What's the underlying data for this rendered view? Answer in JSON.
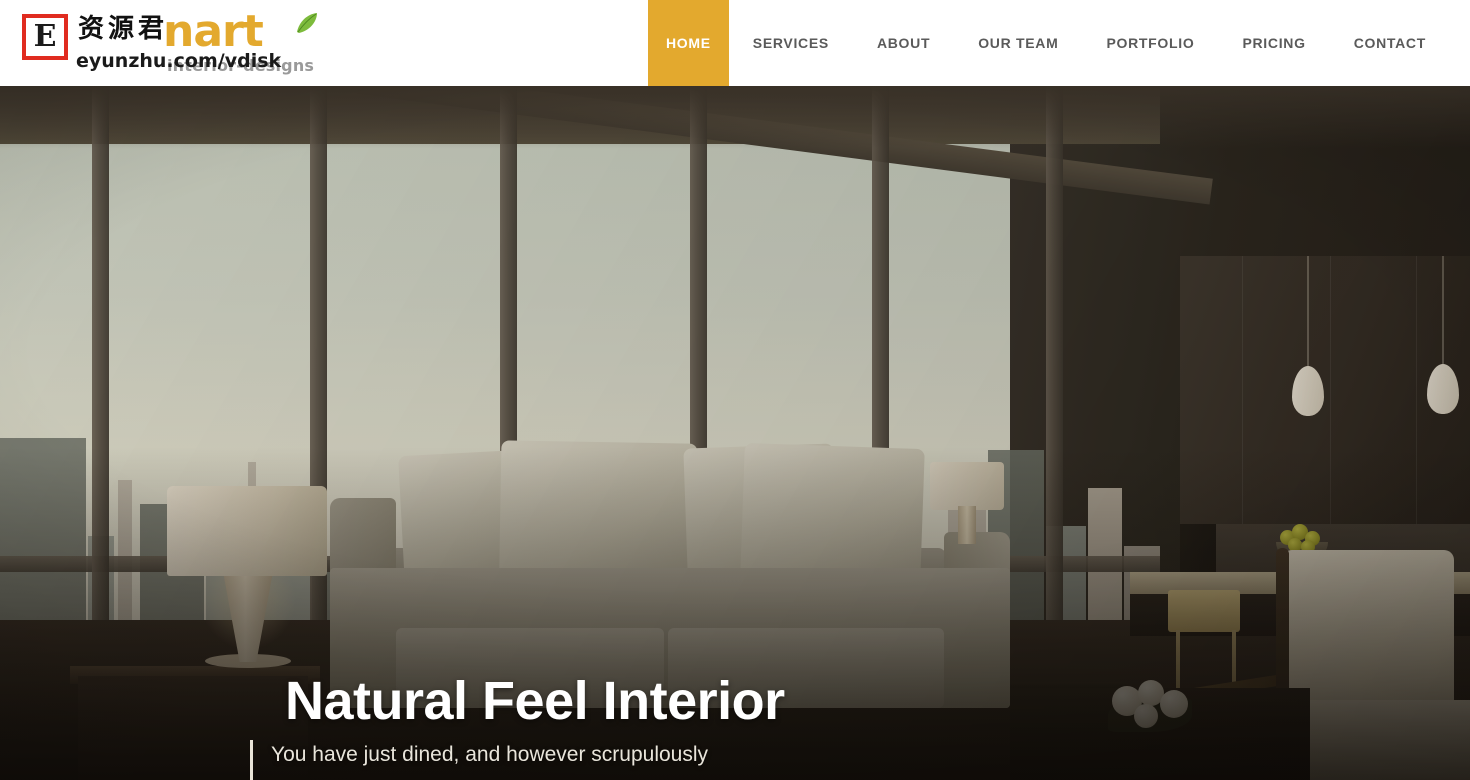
{
  "header": {
    "brand": {
      "name": "nart",
      "tagline": "interior-designs",
      "leaf_icon": "leaf-icon",
      "accent_color": "#E3A92E"
    },
    "watermark": {
      "badge_letter": "E",
      "chinese_text": "资源君",
      "url": "eyunzhu.com/vdisk",
      "badge_color": "#E02B20"
    },
    "nav": {
      "items": [
        {
          "label": "HOME",
          "active": true
        },
        {
          "label": "SERVICES",
          "active": false
        },
        {
          "label": "ABOUT",
          "active": false
        },
        {
          "label": "OUR TEAM",
          "active": false
        },
        {
          "label": "PORTFOLIO",
          "active": false
        },
        {
          "label": "PRICING",
          "active": false
        },
        {
          "label": "CONTACT",
          "active": false
        }
      ],
      "active_bg": "#E3A92E",
      "active_text": "#FFFFFF",
      "text_color": "#5A5A5A"
    }
  },
  "hero": {
    "title": "Natural Feel Interior",
    "subtitle": "You have just dined, and however scrupulously",
    "scene": "modern living room with floor-to-ceiling windows overlooking a city skyline, grey sofa, table lamp, dining counter with pendant lights"
  }
}
